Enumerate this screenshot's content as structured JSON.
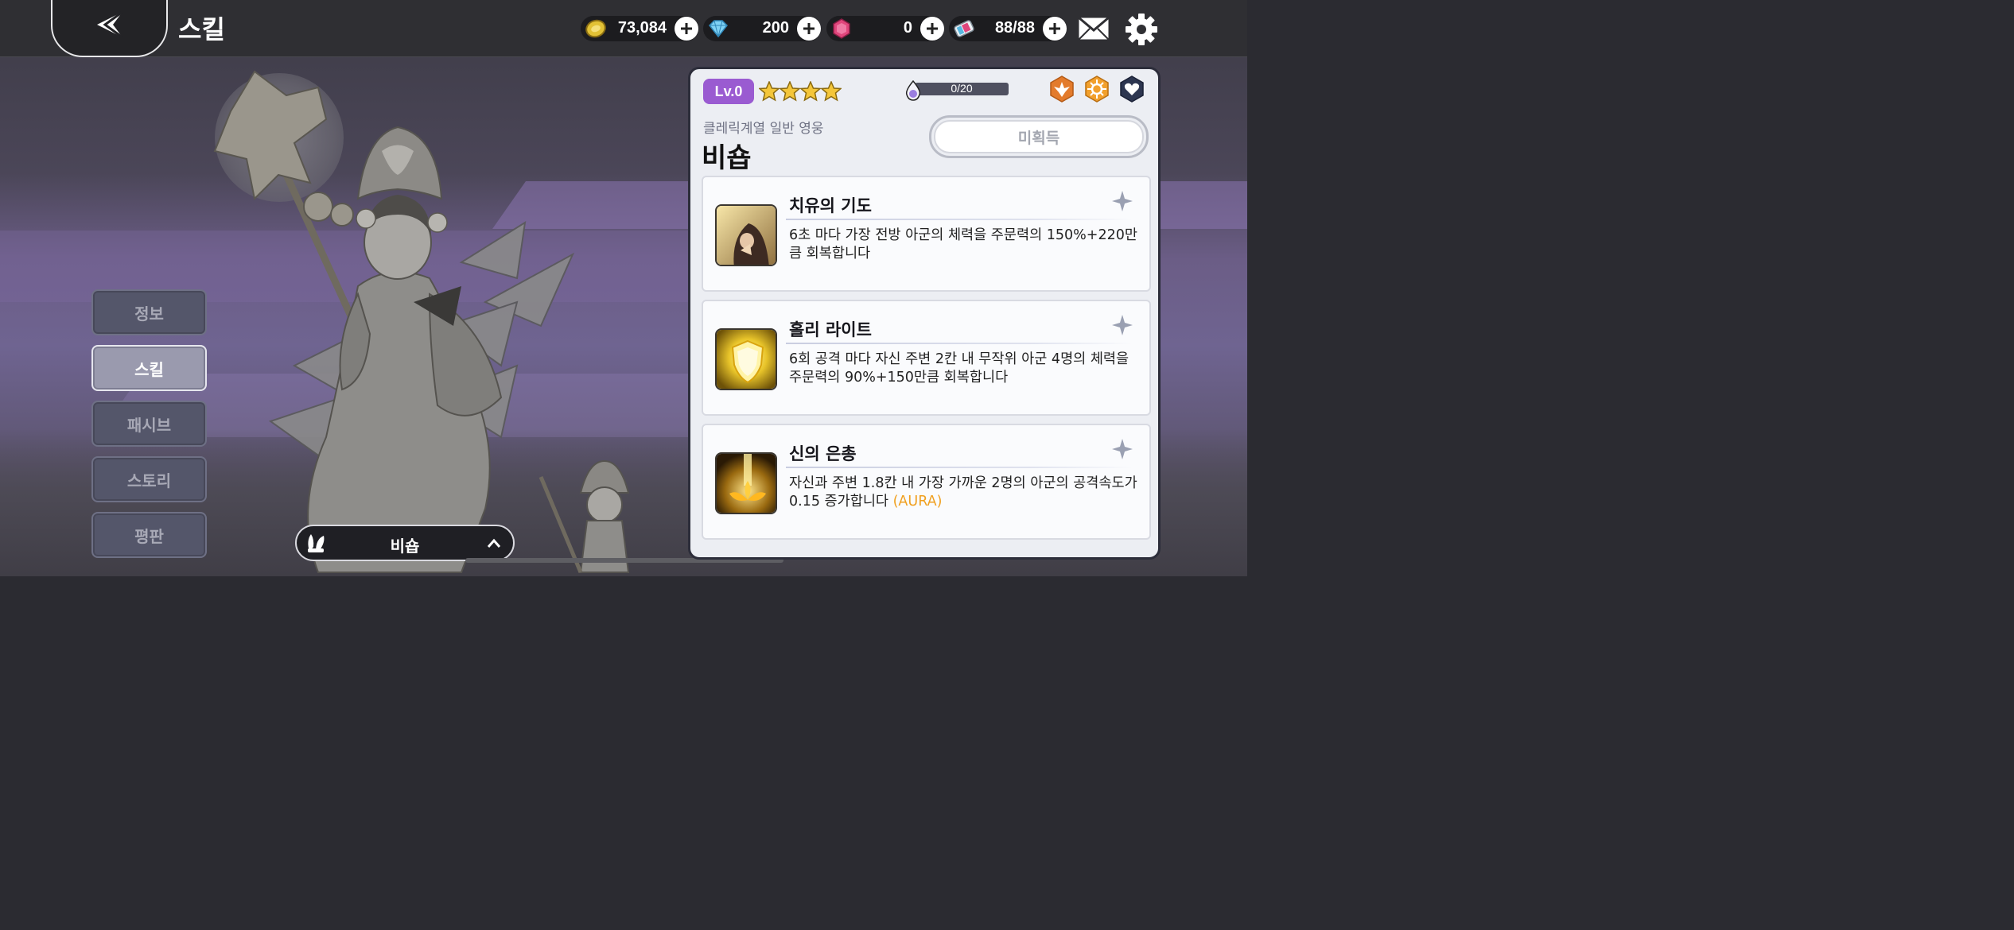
{
  "header": {
    "title": "스킬",
    "currencies": [
      {
        "icon": "gold-coin-icon",
        "value": "73,084"
      },
      {
        "icon": "diamond-icon",
        "value": "200"
      },
      {
        "icon": "ruby-gem-icon",
        "value": "0"
      },
      {
        "icon": "stamina-ticket-icon",
        "value": "88/88"
      }
    ]
  },
  "sidebar": {
    "tabs": [
      {
        "label": "정보",
        "active": false
      },
      {
        "label": "스킬",
        "active": true
      },
      {
        "label": "패시브",
        "active": false
      },
      {
        "label": "스토리",
        "active": false
      },
      {
        "label": "평판",
        "active": false
      }
    ]
  },
  "selector": {
    "name": "비숍"
  },
  "hero": {
    "level": "Lv.0",
    "stars": 4,
    "soul_gauge": {
      "text": "0/20",
      "current": 0,
      "max": 20
    },
    "attributes": [
      "fire-element-icon",
      "sun-element-icon",
      "heart-role-icon"
    ],
    "class_line": "클레릭계열 일반 영웅",
    "name": "비숍",
    "acquire_label": "미획득"
  },
  "skills": [
    {
      "name": "치유의 기도",
      "desc": "6초 마다 가장 전방 아군의 체력을 주문력의 150%+220만큼 회복합니다",
      "desc_suffix": ""
    },
    {
      "name": "홀리 라이트",
      "desc": "6회 공격 마다 자신 주변 2칸 내 무작위 아군 4명의 체력을 주문력의 90%+150만큼 회복합니다",
      "desc_suffix": ""
    },
    {
      "name": "신의 은총",
      "desc": "자신과 주변 1.8칸 내 가장 가까운 2명의 아군의 공격속도가 0.15 증가합니다",
      "desc_suffix": "(AURA)"
    }
  ],
  "colors": {
    "level_badge": "#9a5bd1",
    "aura_text": "#f0a020",
    "active_tab": "#9a9aae"
  }
}
